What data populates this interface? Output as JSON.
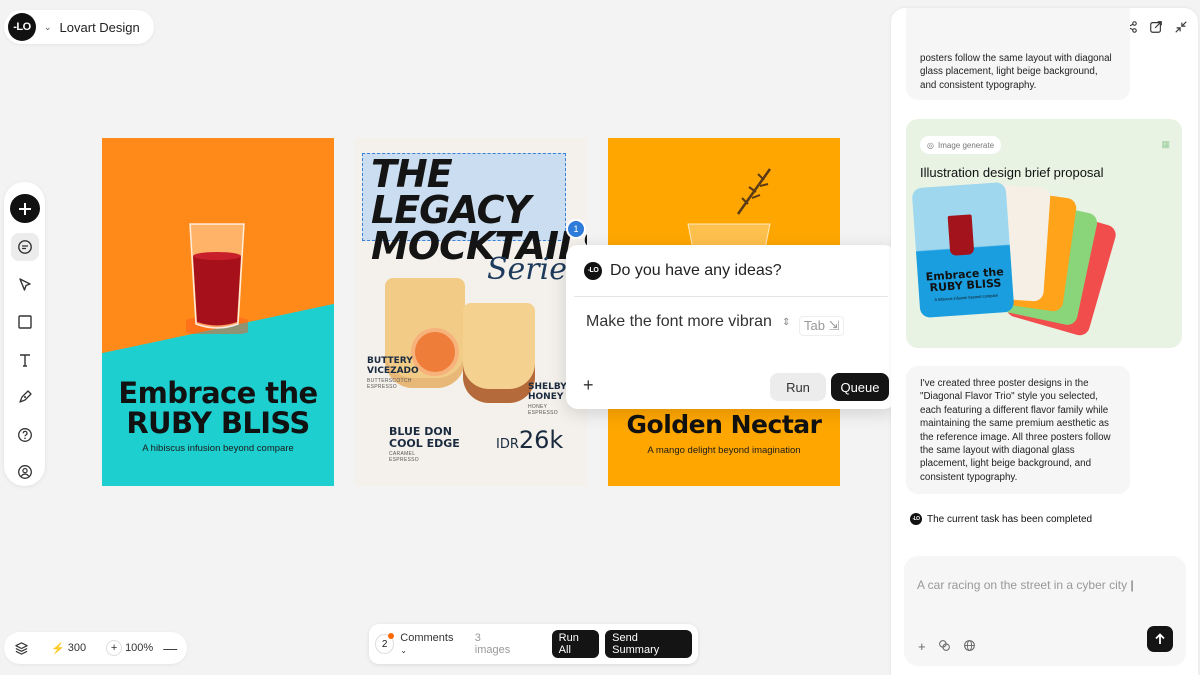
{
  "brand": {
    "logo_text": "-LO",
    "name": "Lovart Design"
  },
  "toolbar": {
    "icons": [
      "plus-icon",
      "chat-icon",
      "pointer-icon",
      "rectangle-icon",
      "text-icon",
      "pen-icon",
      "help-icon",
      "user-icon"
    ]
  },
  "posters": [
    {
      "title": "Embrace the RUBY BLISS",
      "title_l1": "Embrace the",
      "title_l2": "RUBY BLISS",
      "subtitle": "A hibiscus infusion beyond compare"
    },
    {
      "title_l1": "THE",
      "title_l2": "LEGACY",
      "title_l3": "MOCKTAILS",
      "series": "Series",
      "item1_name_l1": "BUTTERY",
      "item1_name_l2": "VICEZADO",
      "item1_sub_l1": "BUTTERSCOTCH",
      "item1_sub_l2": "ESPRESSO",
      "item2_name_l1": "SHELBY'S",
      "item2_name_l2": "HONEY",
      "item2_sub_l1": "HONEY",
      "item2_sub_l2": "ESPRESSO",
      "item3_name_l1": "BLUE DON",
      "item3_name_l2": "COOL EDGE",
      "item3_sub_l1": "CARAMEL",
      "item3_sub_l2": "ESPRESSO",
      "price_prefix": "IDR",
      "price": "26k",
      "selection_badge": "1"
    },
    {
      "title": "Golden Nectar",
      "subtitle": "A mango delight beyond imagination"
    }
  ],
  "popup": {
    "question": "Do you have any ideas?",
    "input_value": "Make the font more vibran",
    "tab_hint": "Tab",
    "run_label": "Run",
    "queue_label": "Queue"
  },
  "bottom_left": {
    "credits": "300",
    "zoom": "100%"
  },
  "bottom_center": {
    "comment_count": "2",
    "comments_label": "Comments",
    "images_label": "3 images",
    "run_all_label": "Run All",
    "send_summary_label": "Send Summary"
  },
  "panel": {
    "header_icons": [
      "new-chat-icon",
      "history-icon",
      "share-icon",
      "open-icon",
      "collapse-icon"
    ],
    "msg1": "posters follow the same layout with diagonal glass placement, light beige background, and consistent typography.",
    "gen_chip": "Image generate",
    "gen_title": "Illustration design brief proposal",
    "thumb_title": "Embrace the RUBY BLISS",
    "thumb_sub": "A hibiscus infusion beyond compare",
    "msg2": "I've created three poster designs in the \"Diagonal Flavor Trio\" style you selected, each featuring a different flavor family while maintaining the same premium aesthetic as the reference image. All three posters follow the same layout with diagonal glass placement, light beige background, and consistent typography.",
    "done": "The current task has been completed",
    "input_placeholder": "A car racing on the street in a cyber city"
  }
}
